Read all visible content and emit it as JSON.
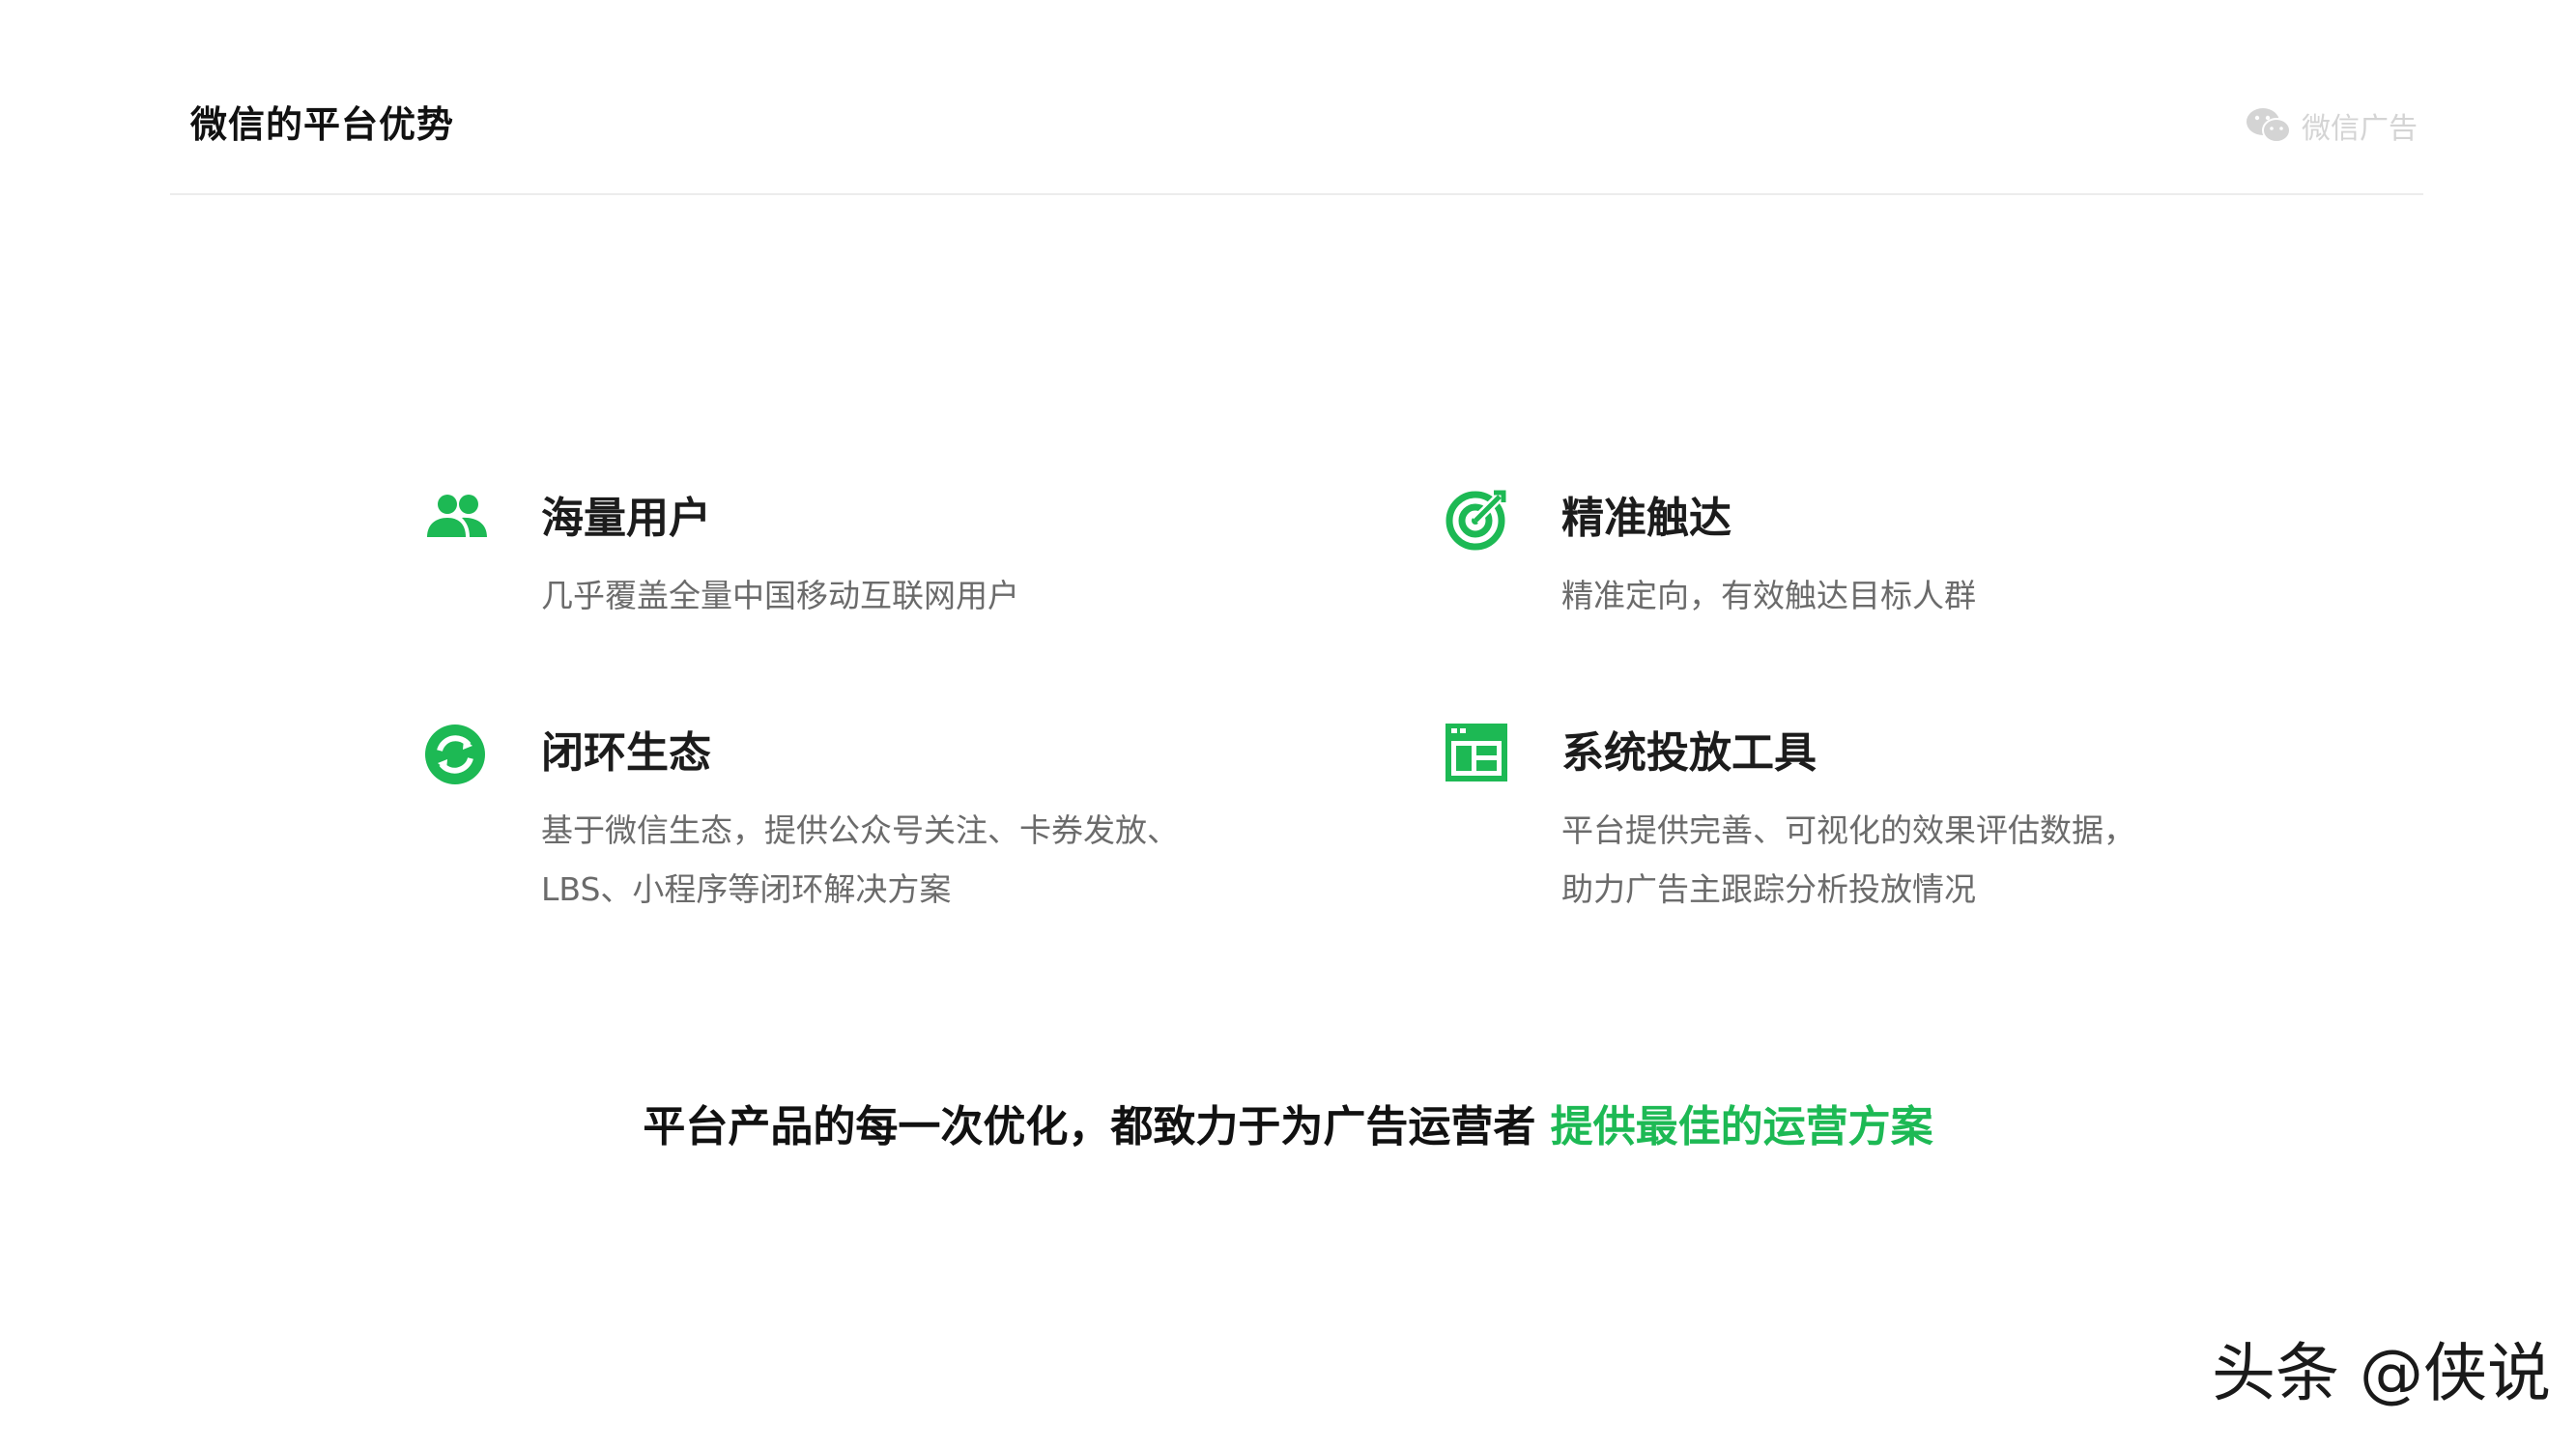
{
  "header": {
    "title": "微信的平台优势",
    "brand_text": "微信广告"
  },
  "features": [
    {
      "icon": "users-icon",
      "title": "海量用户",
      "desc_lines": [
        "几乎覆盖全量中国移动互联网用户"
      ]
    },
    {
      "icon": "target-icon",
      "title": "精准触达",
      "desc_lines": [
        "精准定向，有效触达目标人群"
      ]
    },
    {
      "icon": "loop-icon",
      "title": "闭环生态",
      "desc_lines": [
        "基于微信生态，提供公众号关注、卡券发放、",
        "LBS、小程序等闭环解决方案"
      ]
    },
    {
      "icon": "dashboard-icon",
      "title": "系统投放工具",
      "desc_lines": [
        "平台提供完善、可视化的效果评估数据，",
        "助力广告主跟踪分析投放情况"
      ]
    }
  ],
  "slogan": {
    "prefix": "平台产品的每一次优化，都致力于为广告运营者 ",
    "highlight": "提供最佳的运营方案"
  },
  "watermark": "头条 @侠说",
  "colors": {
    "accent": "#1db954",
    "brand_gray": "#d4d4d4"
  }
}
